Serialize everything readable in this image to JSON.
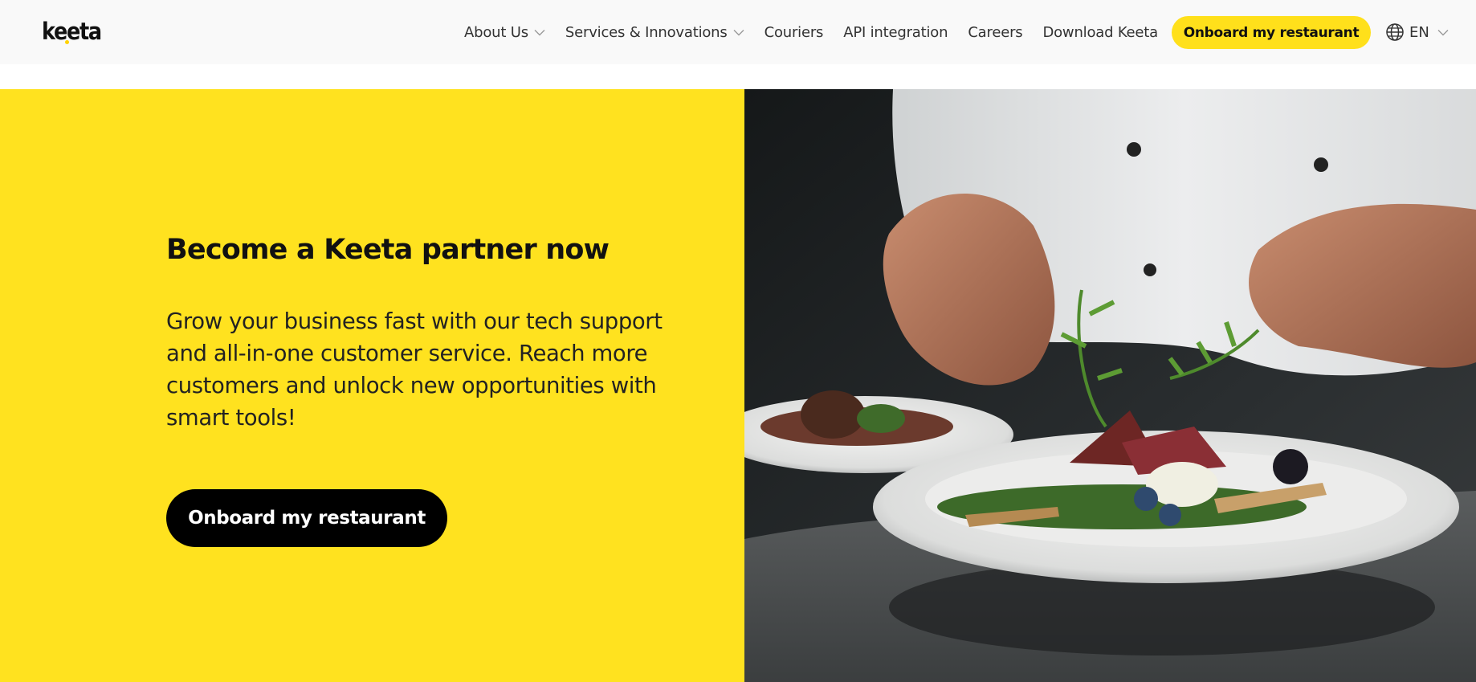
{
  "header": {
    "logo": "keeta",
    "nav": [
      {
        "label": "About Us",
        "has_dropdown": true
      },
      {
        "label": "Services & Innovations",
        "has_dropdown": true
      },
      {
        "label": "Couriers",
        "has_dropdown": false
      },
      {
        "label": "API integration",
        "has_dropdown": false
      },
      {
        "label": "Careers",
        "has_dropdown": false
      },
      {
        "label": "Download Keeta",
        "has_dropdown": false
      }
    ],
    "cta_label": "Onboard my restaurant",
    "language": {
      "label": "EN",
      "icon": "globe-icon"
    }
  },
  "hero": {
    "title": "Become a Keeta partner now",
    "description": "Grow your business fast with our tech support and all-in-one customer service. Reach more customers and unlock new opportunities with smart tools!",
    "cta_label": "Onboard my restaurant",
    "image_subject": "chef-plating-dish-photo"
  },
  "colors": {
    "brand_yellow": "#ffe21f",
    "cta_header_yellow": "#ffe01b",
    "cta_dark": "#000000",
    "header_bg": "#f9f9f9"
  }
}
